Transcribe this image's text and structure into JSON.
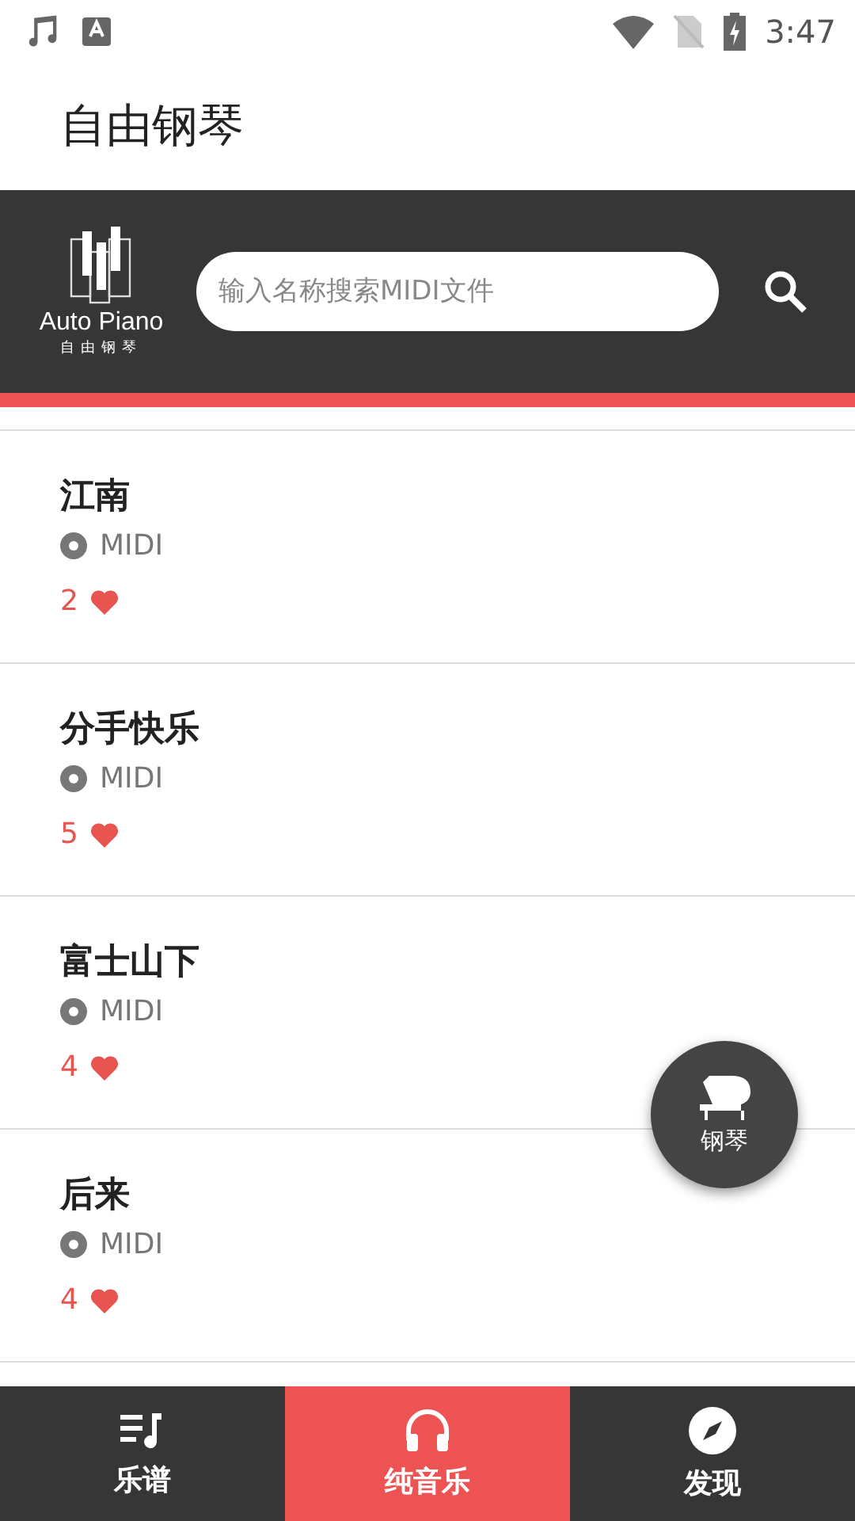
{
  "status_bar": {
    "time": "3:47"
  },
  "title": "自由钢琴",
  "header": {
    "logo_text": "Auto Piano",
    "logo_subtext": "自由钢琴",
    "search": {
      "placeholder": "输入名称搜索MIDI文件"
    }
  },
  "songs": [
    {
      "title": "江南",
      "type": "MIDI",
      "likes": "2"
    },
    {
      "title": "分手快乐",
      "type": "MIDI",
      "likes": "5"
    },
    {
      "title": "富士山下",
      "type": "MIDI",
      "likes": "4"
    },
    {
      "title": "后来",
      "type": "MIDI",
      "likes": "4"
    }
  ],
  "fab": {
    "label": "钢琴"
  },
  "tabs": [
    {
      "label": "乐谱",
      "kind": "score",
      "selected": false
    },
    {
      "label": "纯音乐",
      "kind": "headphones",
      "selected": true
    },
    {
      "label": "发现",
      "kind": "compass",
      "selected": false
    }
  ]
}
